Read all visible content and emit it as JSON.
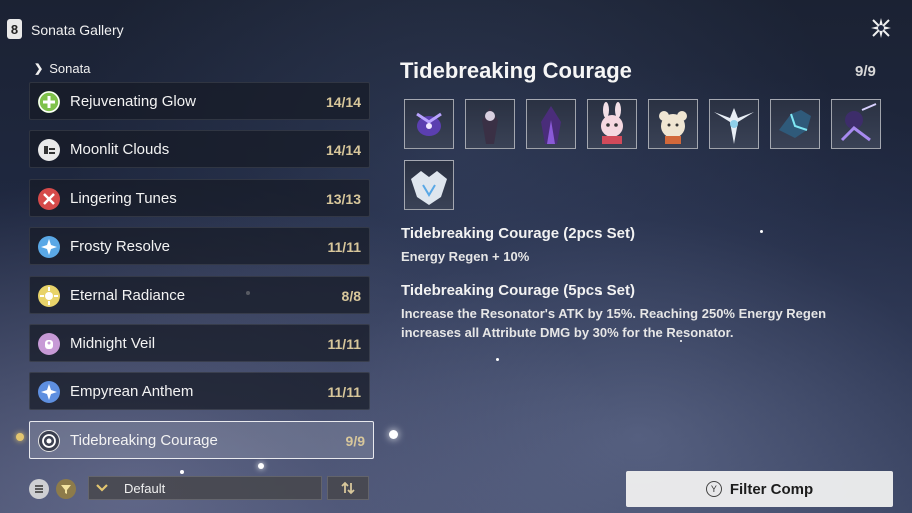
{
  "header": {
    "app_badge": "8",
    "app_title": "Sonata Gallery",
    "close_icon": "close-sparkle-icon"
  },
  "breadcrumb": {
    "label": "Sonata"
  },
  "sonata_list": [
    {
      "name": "Rejuvenating Glow",
      "count": "14/14",
      "icon": "plus-icon",
      "color": "#7fc24a"
    },
    {
      "name": "Moonlit Clouds",
      "count": "14/14",
      "icon": "cloud-icon",
      "color": "#e9e9e9"
    },
    {
      "name": "Lingering Tunes",
      "count": "13/13",
      "icon": "crossed-swords-icon",
      "color": "#d64a4a"
    },
    {
      "name": "Frosty Resolve",
      "count": "11/11",
      "icon": "snowflake-icon",
      "color": "#5aa8e6"
    },
    {
      "name": "Eternal Radiance",
      "count": "8/8",
      "icon": "sun-icon",
      "color": "#e8d36a"
    },
    {
      "name": "Midnight Veil",
      "count": "11/11",
      "icon": "veil-icon",
      "color": "#c79ad6"
    },
    {
      "name": "Empyrean Anthem",
      "count": "11/11",
      "icon": "star-icon",
      "color": "#5e8fe0"
    },
    {
      "name": "Tidebreaking Courage",
      "count": "9/9",
      "icon": "target-icon",
      "color": "#dcdcdc",
      "selected": true
    }
  ],
  "bottombar": {
    "list_icon": "list-icon",
    "filter_icon": "funnel-icon",
    "sort_value": "Default",
    "order_icon": "sort-order-icon"
  },
  "detail": {
    "title": "Tidebreaking Courage",
    "count": "9/9",
    "echoes": [
      "echo-purple-bird",
      "echo-dark-hooded",
      "echo-purple-robed",
      "echo-pink-rabbit",
      "echo-cream-bear",
      "echo-white-winged",
      "echo-cyan-wolf",
      "echo-purple-knight",
      "echo-white-dragon"
    ],
    "bonus_2pc_title": "Tidebreaking Courage (2pcs Set)",
    "bonus_2pc_text": "Energy Regen + 10%",
    "bonus_5pc_title": "Tidebreaking Courage (5pcs Set)",
    "bonus_5pc_text": "Increase the Resonator's ATK by 15%. Reaching 250% Energy Regen increases all Attribute DMG by 30% for the Resonator."
  },
  "filter_button": {
    "key_hint": "Y",
    "label": "Filter Comp"
  }
}
